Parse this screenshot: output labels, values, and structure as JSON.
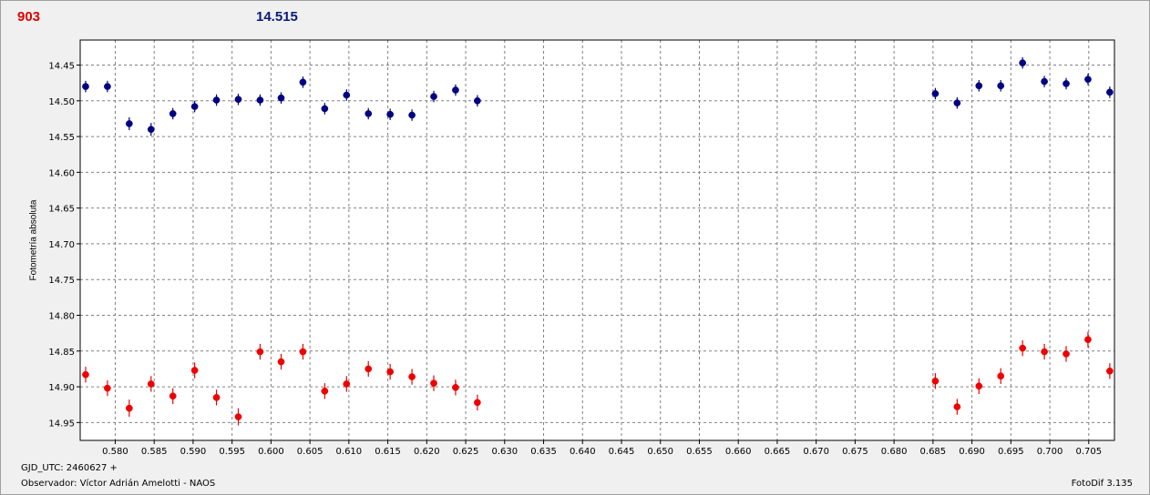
{
  "header": {
    "left_value": "903",
    "right_value": "14.515",
    "left_color": "#dd0000",
    "right_color": "#0a1a7a"
  },
  "footer": {
    "gjd": "GJD_UTC: 2460627 +",
    "observer": "Observador: Víctor Adrián Amelotti - NAOS",
    "software": "FotoDif 3.135"
  },
  "chart_data": {
    "type": "scatter",
    "title": "",
    "xlabel": "",
    "ylabel": "Fotometría absoluta",
    "xlim": [
      0.5755,
      0.7083
    ],
    "ylim": [
      14.415,
      14.975
    ],
    "y_inverted": true,
    "grid": true,
    "x_ticks": [
      "0.580",
      "0.585",
      "0.590",
      "0.595",
      "0.600",
      "0.605",
      "0.610",
      "0.615",
      "0.620",
      "0.625",
      "0.630",
      "0.635",
      "0.640",
      "0.645",
      "0.650",
      "0.655",
      "0.660",
      "0.665",
      "0.670",
      "0.675",
      "0.680",
      "0.685",
      "0.690",
      "0.695",
      "0.700",
      "0.705"
    ],
    "y_ticks": [
      "14.45",
      "14.50",
      "14.55",
      "14.60",
      "14.65",
      "14.70",
      "14.75",
      "14.80",
      "14.85",
      "14.90",
      "14.95"
    ],
    "series": [
      {
        "color": "#000080",
        "x": [
          0.5762,
          0.579,
          0.5818,
          0.5846,
          0.5874,
          0.5902,
          0.593,
          0.5958,
          0.5986,
          0.6013,
          0.6041,
          0.6069,
          0.6097,
          0.6125,
          0.6153,
          0.6181,
          0.6209,
          0.6237,
          0.6265,
          0.6853,
          0.6881,
          0.6909,
          0.6937,
          0.6965,
          0.6993,
          0.7021,
          0.7049,
          0.7077
        ],
        "y": [
          14.48,
          14.48,
          14.532,
          14.54,
          14.518,
          14.508,
          14.499,
          14.498,
          14.499,
          14.496,
          14.474,
          14.511,
          14.492,
          14.518,
          14.519,
          14.52,
          14.494,
          14.485,
          14.5,
          14.49,
          14.503,
          14.479,
          14.479,
          14.447,
          14.473,
          14.476,
          14.47,
          14.488
        ],
        "err": [
          0.008,
          0.008,
          0.009,
          0.009,
          0.008,
          0.008,
          0.008,
          0.008,
          0.008,
          0.008,
          0.008,
          0.008,
          0.008,
          0.008,
          0.008,
          0.008,
          0.008,
          0.008,
          0.008,
          0.008,
          0.008,
          0.008,
          0.008,
          0.008,
          0.008,
          0.008,
          0.008,
          0.008
        ]
      },
      {
        "color": "#ee0000",
        "x": [
          0.5762,
          0.579,
          0.5818,
          0.5846,
          0.5874,
          0.5902,
          0.593,
          0.5958,
          0.5986,
          0.6013,
          0.6041,
          0.6069,
          0.6097,
          0.6125,
          0.6153,
          0.6181,
          0.6209,
          0.6237,
          0.6265,
          0.6853,
          0.6881,
          0.6909,
          0.6937,
          0.6965,
          0.6993,
          0.7021,
          0.7049,
          0.7077
        ],
        "y": [
          14.883,
          14.902,
          14.93,
          14.896,
          14.913,
          14.877,
          14.915,
          14.942,
          14.851,
          14.865,
          14.851,
          14.906,
          14.896,
          14.875,
          14.879,
          14.886,
          14.895,
          14.901,
          14.922,
          14.892,
          14.928,
          14.899,
          14.885,
          14.846,
          14.851,
          14.854,
          14.834,
          14.878
        ],
        "err": [
          0.011,
          0.011,
          0.012,
          0.011,
          0.011,
          0.011,
          0.011,
          0.012,
          0.011,
          0.011,
          0.011,
          0.011,
          0.011,
          0.011,
          0.011,
          0.011,
          0.011,
          0.011,
          0.011,
          0.011,
          0.011,
          0.011,
          0.011,
          0.011,
          0.011,
          0.011,
          0.011,
          0.011
        ]
      }
    ]
  }
}
